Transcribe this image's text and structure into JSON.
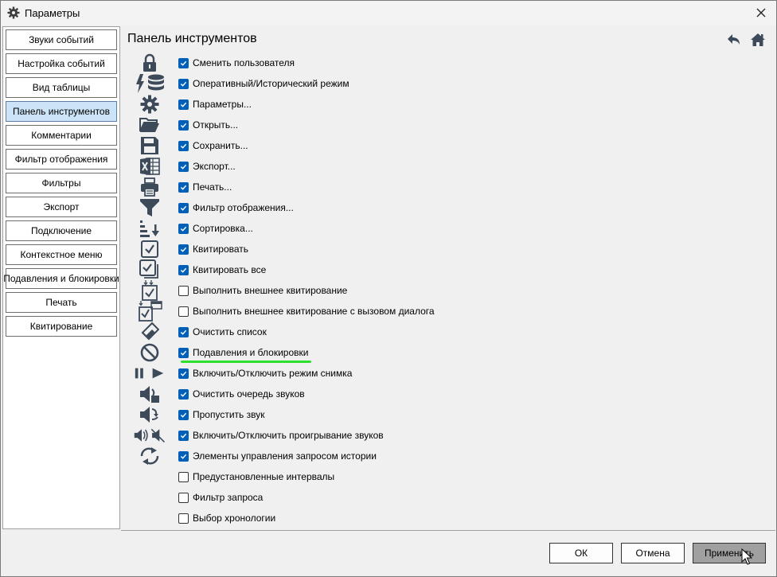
{
  "window": {
    "title": "Параметры"
  },
  "sidebar": {
    "items": [
      {
        "label": "Звуки событий"
      },
      {
        "label": "Настройка событий"
      },
      {
        "label": "Вид таблицы"
      },
      {
        "label": "Панель инструментов",
        "active": true
      },
      {
        "label": "Комментарии"
      },
      {
        "label": "Фильтр отображения"
      },
      {
        "label": "Фильтры"
      },
      {
        "label": "Экспорт"
      },
      {
        "label": "Подключение"
      },
      {
        "label": "Контекстное меню"
      },
      {
        "label": "Подавления и блокировки"
      },
      {
        "label": "Печать"
      },
      {
        "label": "Квитирование"
      }
    ]
  },
  "panel": {
    "title": "Панель инструментов",
    "items": [
      {
        "label": "Сменить пользователя",
        "checked": true,
        "icon": "lock-icon"
      },
      {
        "label": "Оперативный/Исторический режим",
        "checked": true,
        "icon": "lightning-database-icon"
      },
      {
        "label": "Параметры...",
        "checked": true,
        "icon": "gear-icon"
      },
      {
        "label": "Открыть...",
        "checked": true,
        "icon": "folder-open-icon"
      },
      {
        "label": "Сохранить...",
        "checked": true,
        "icon": "floppy-disk-icon"
      },
      {
        "label": "Экспорт...",
        "checked": true,
        "icon": "excel-export-icon"
      },
      {
        "label": "Печать...",
        "checked": true,
        "icon": "printer-icon"
      },
      {
        "label": "Фильтр отображения...",
        "checked": true,
        "icon": "funnel-icon"
      },
      {
        "label": "Сортировка...",
        "checked": true,
        "icon": "sort-descending-icon"
      },
      {
        "label": "Квитировать",
        "checked": true,
        "icon": "check-box-icon"
      },
      {
        "label": "Квитировать все",
        "checked": true,
        "icon": "check-all-icon"
      },
      {
        "label": "Выполнить внешнее квитирование",
        "checked": false,
        "icon": "external-ack-icon"
      },
      {
        "label": "Выполнить внешнее квитирование с вызовом диалога",
        "checked": false,
        "icon": "external-ack-dialog-icon"
      },
      {
        "label": "Очистить список",
        "checked": true,
        "icon": "eraser-icon"
      },
      {
        "label": "Подавления и блокировки",
        "checked": true,
        "icon": "prohibited-icon"
      },
      {
        "label": "Включить/Отключить режим снимка",
        "checked": true,
        "icon": "pause-play-icon"
      },
      {
        "label": "Очистить очередь звуков",
        "checked": true,
        "icon": "speaker-clear-icon"
      },
      {
        "label": "Пропустить звук",
        "checked": true,
        "icon": "speaker-skip-icon"
      },
      {
        "label": "Включить/Отключить проигрывание звуков",
        "checked": true,
        "icon": "speaker-mute-icon"
      },
      {
        "label": "Элементы управления запросом истории",
        "checked": true,
        "icon": "history-arrows-icon"
      },
      {
        "label": "Предустановленные интервалы",
        "checked": false,
        "icon": ""
      },
      {
        "label": "Фильтр запроса",
        "checked": false,
        "icon": ""
      },
      {
        "label": "Выбор хронологии",
        "checked": false,
        "icon": ""
      }
    ]
  },
  "footer": {
    "ok": "ОК",
    "cancel": "Отмена",
    "apply": "Применить"
  }
}
